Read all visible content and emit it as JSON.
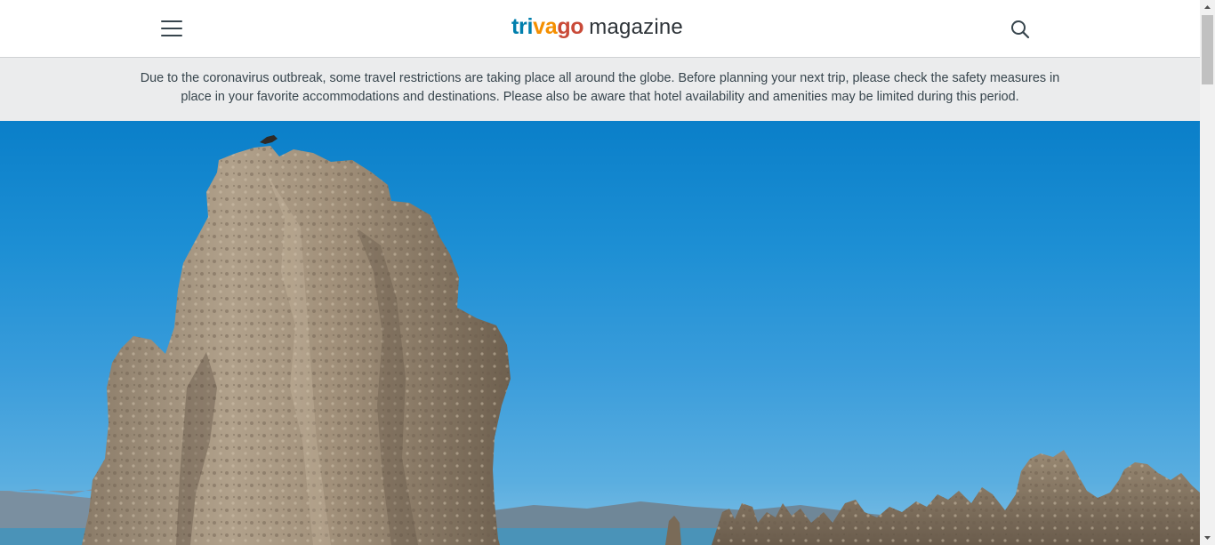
{
  "header": {
    "menu_icon": "hamburger-menu-icon",
    "logo": {
      "tri": "tri",
      "va": "va",
      "go": "go",
      "magazine": "magazine"
    },
    "search_icon": "search-icon"
  },
  "notice": {
    "text": "Due to the coronavirus outbreak, some travel restrictions are taking place all around the globe. Before planning your next trip, please check the safety measures in place in your favorite accommodations and destinations. Please also be aware that hotel availability and amenities may be limited during this period."
  },
  "hero": {
    "image": "tufa-rock-formations-lake-photo"
  },
  "colors": {
    "logo_blue": "#007fad",
    "logo_orange": "#f48f00",
    "logo_red": "#c94a38",
    "notice_bg": "#ebeced",
    "text_dark": "#37454d",
    "sky": "#1d8fd4"
  }
}
